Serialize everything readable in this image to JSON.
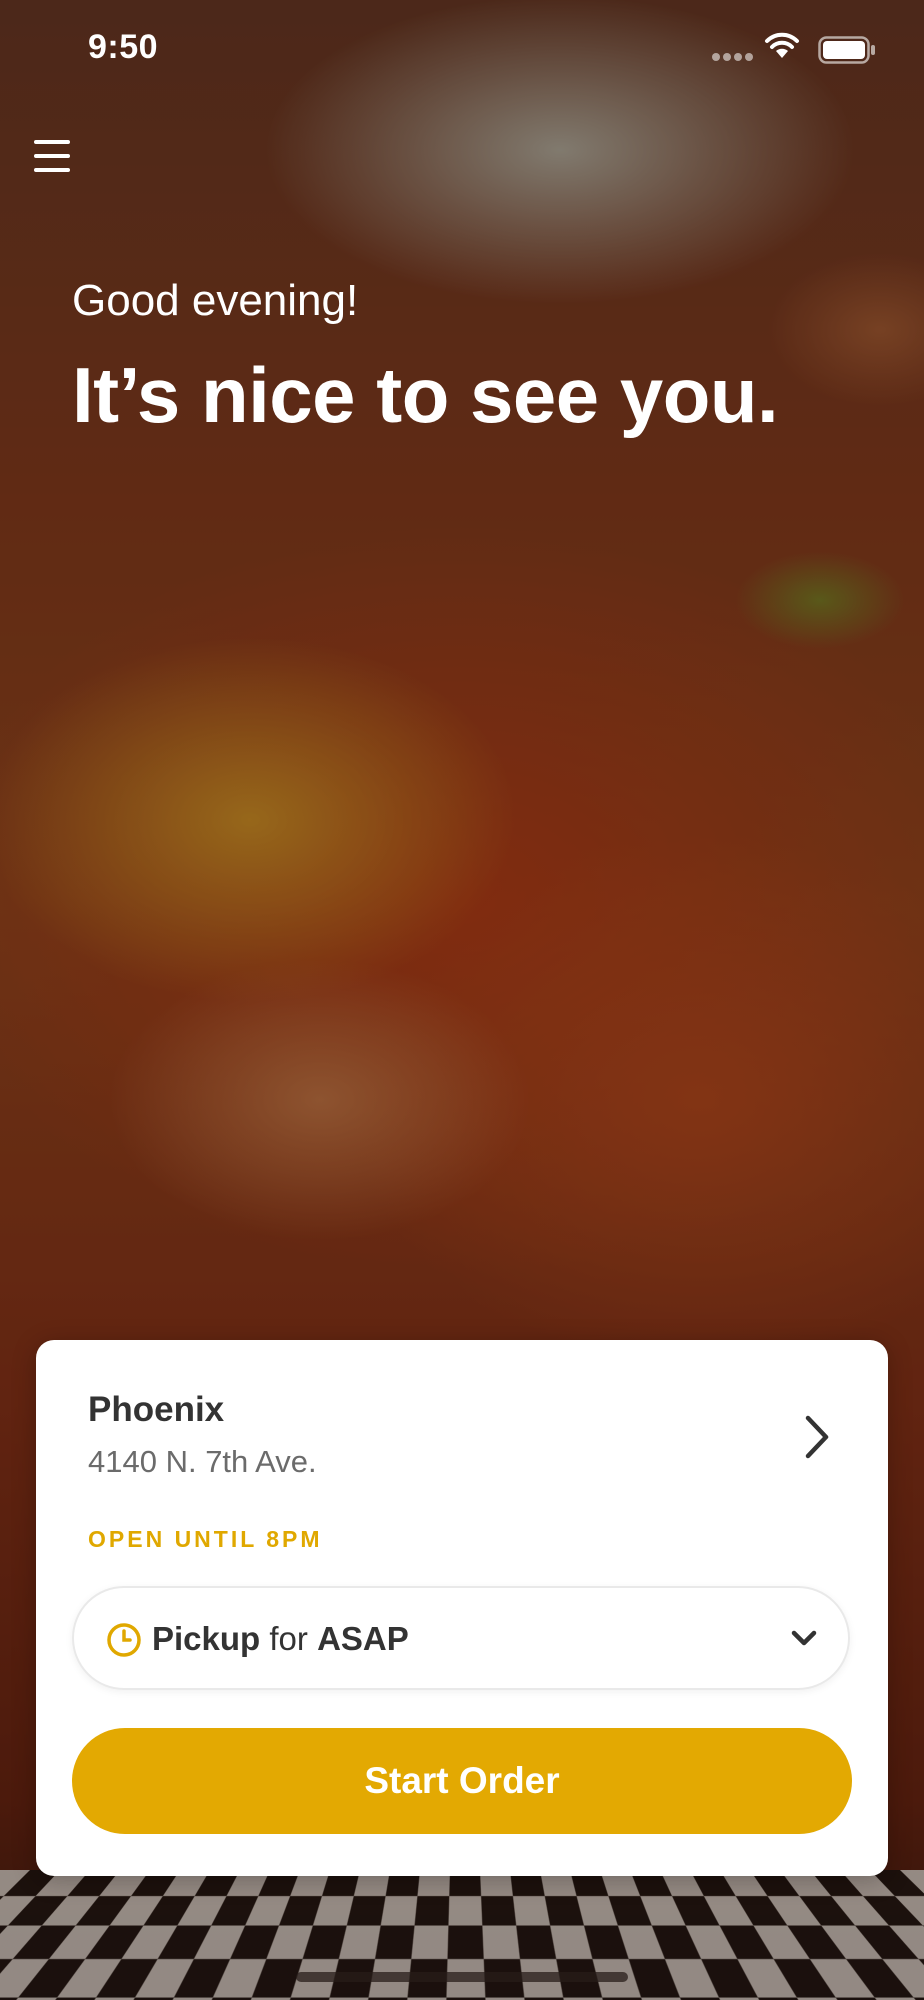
{
  "status_bar": {
    "time": "9:50",
    "icons": [
      "cellular-signal-icon",
      "wifi-icon",
      "battery-icon"
    ]
  },
  "header": {
    "menu_icon": "hamburger-menu-icon",
    "greeting": "Good evening!",
    "headline": "It’s nice to see you."
  },
  "location_card": {
    "city": "Phoenix",
    "address": "4140 N. 7th Ave.",
    "open_status": "OPEN UNTIL 8PM",
    "chevron_icon": "chevron-right-icon",
    "pickup": {
      "clock_icon": "clock-icon",
      "mode": "Pickup",
      "connector": "for",
      "time": "ASAP",
      "dropdown_icon": "chevron-down-icon"
    },
    "start_button": "Start Order"
  },
  "colors": {
    "accent": "#e3a902",
    "open_status": "#e0a800",
    "card_background": "#ffffff",
    "text_dark": "#333333",
    "text_muted": "#6b6b6b"
  }
}
